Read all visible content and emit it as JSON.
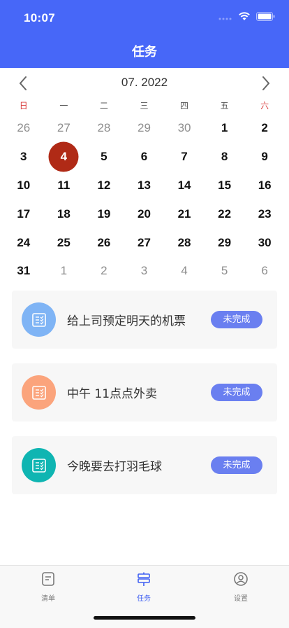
{
  "status_bar": {
    "time": "10:07"
  },
  "header": {
    "title": "任务"
  },
  "calendar": {
    "month_label": "07. 2022",
    "weekdays": [
      "日",
      "一",
      "二",
      "三",
      "四",
      "五",
      "六"
    ],
    "days": [
      {
        "label": "26",
        "muted": true
      },
      {
        "label": "27",
        "muted": true
      },
      {
        "label": "28",
        "muted": true
      },
      {
        "label": "29",
        "muted": true
      },
      {
        "label": "30",
        "muted": true
      },
      {
        "label": "1"
      },
      {
        "label": "2"
      },
      {
        "label": "3"
      },
      {
        "label": "4",
        "selected": true
      },
      {
        "label": "5"
      },
      {
        "label": "6"
      },
      {
        "label": "7"
      },
      {
        "label": "8"
      },
      {
        "label": "9"
      },
      {
        "label": "10"
      },
      {
        "label": "11"
      },
      {
        "label": "12"
      },
      {
        "label": "13"
      },
      {
        "label": "14"
      },
      {
        "label": "15"
      },
      {
        "label": "16"
      },
      {
        "label": "17"
      },
      {
        "label": "18"
      },
      {
        "label": "19"
      },
      {
        "label": "20"
      },
      {
        "label": "21"
      },
      {
        "label": "22"
      },
      {
        "label": "23"
      },
      {
        "label": "24"
      },
      {
        "label": "25"
      },
      {
        "label": "26"
      },
      {
        "label": "27"
      },
      {
        "label": "28"
      },
      {
        "label": "29"
      },
      {
        "label": "30"
      },
      {
        "label": "31"
      },
      {
        "label": "1",
        "muted": true
      },
      {
        "label": "2",
        "muted": true
      },
      {
        "label": "3",
        "muted": true
      },
      {
        "label": "4",
        "muted": true
      },
      {
        "label": "5",
        "muted": true
      },
      {
        "label": "6",
        "muted": true
      }
    ]
  },
  "tasks": [
    {
      "text": "给上司预定明天的机票",
      "status": "未完成",
      "icon": "checklist-icon",
      "color": "#7fb4f5"
    },
    {
      "text": "中午 11点点外卖",
      "status": "未完成",
      "icon": "checklist-icon",
      "color": "#fba47c"
    },
    {
      "text": "今晚要去打羽毛球",
      "status": "未完成",
      "icon": "checklist-icon",
      "color": "#0fb5b2"
    }
  ],
  "tabbar": {
    "items": [
      {
        "label": "清单",
        "icon": "list-icon"
      },
      {
        "label": "任务",
        "icon": "task-icon",
        "active": true
      },
      {
        "label": "设置",
        "icon": "settings-icon"
      }
    ]
  },
  "colors": {
    "header": "#4767f8",
    "selected_day": "#b02a16",
    "status_button": "#6a7ff0",
    "active_tab": "#3f5ff2"
  }
}
